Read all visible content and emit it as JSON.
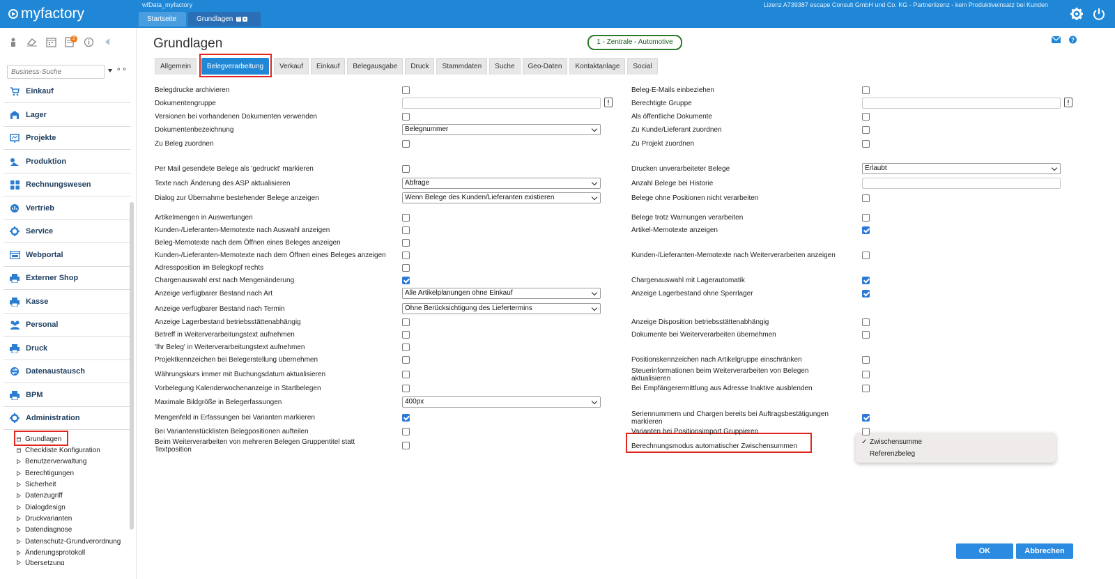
{
  "app": {
    "logo": "myfactory",
    "db_name": "wfData_myfactory",
    "license": "Lizenz A739387 escape Consult GmbH und Co. KG - Partnerlizenz - kein Produktiveinsatz bei Kunden",
    "top_tabs": [
      {
        "label": "Startseite"
      },
      {
        "label": "Grundlagen"
      }
    ],
    "accent": "#1f87d6"
  },
  "sidebar": {
    "notif_badge": "2",
    "search_placeholder": "Business-Suche",
    "search_options_icon": "⚬⚬",
    "items": [
      {
        "label": "Einkauf",
        "icon": "cart-icon"
      },
      {
        "label": "Lager",
        "icon": "warehouse-icon"
      },
      {
        "label": "Projekte",
        "icon": "project-icon"
      },
      {
        "label": "Produktion",
        "icon": "production-icon"
      },
      {
        "label": "Rechnungswesen",
        "icon": "grid-icon"
      },
      {
        "label": "Vertrieb",
        "icon": "sales-icon"
      },
      {
        "label": "Service",
        "icon": "service-gear-icon"
      },
      {
        "label": "Webportal",
        "icon": "webportal-icon"
      },
      {
        "label": "Externer Shop",
        "icon": "printer-icon"
      },
      {
        "label": "Kasse",
        "icon": "register-icon"
      },
      {
        "label": "Personal",
        "icon": "people-icon"
      },
      {
        "label": "Druck",
        "icon": "printer-icon"
      },
      {
        "label": "Datenaustausch",
        "icon": "exchange-icon"
      },
      {
        "label": "BPM",
        "icon": "printer-icon"
      },
      {
        "label": "Administration",
        "icon": "admin-gear-icon"
      }
    ],
    "subitems": [
      {
        "label": "Grundlagen"
      },
      {
        "label": "Checkliste Konfiguration"
      },
      {
        "label": "Benutzerverwaltung"
      },
      {
        "label": "Berechtigungen"
      },
      {
        "label": "Sicherheit"
      },
      {
        "label": "Datenzugriff"
      },
      {
        "label": "Dialogdesign"
      },
      {
        "label": "Druckvarianten"
      },
      {
        "label": "Datendiagnose"
      },
      {
        "label": "Datenschutz-Grundverordnung"
      },
      {
        "label": "Änderungsprotokoll"
      },
      {
        "label": "Übersetzung"
      }
    ]
  },
  "main": {
    "title": "Grundlagen",
    "mandant": "1 - Zentrale - Automotive",
    "tabs": [
      {
        "label": "Allgemein"
      },
      {
        "label": "Belegverarbeitung"
      },
      {
        "label": "Verkauf"
      },
      {
        "label": "Einkauf"
      },
      {
        "label": "Belegausgabe"
      },
      {
        "label": "Druck"
      },
      {
        "label": "Stammdaten"
      },
      {
        "label": "Suche"
      },
      {
        "label": "Geo-Daten"
      },
      {
        "label": "Kontaktanlage"
      },
      {
        "label": "Social"
      }
    ],
    "left_settings": [
      {
        "label": "Belegdrucke archivieren",
        "type": "checkbox",
        "checked": false
      },
      {
        "label": "Dokumentengruppe",
        "type": "text",
        "value": ""
      },
      {
        "label": "Versionen bei vorhandenen Dokumenten verwenden",
        "type": "checkbox",
        "checked": false
      },
      {
        "label": "Dokumentenbezeichnung",
        "type": "select",
        "value": "Belegnummer"
      },
      {
        "label": "Zu Beleg zuordnen",
        "type": "checkbox",
        "checked": false
      },
      {
        "label": "Per Mail gesendete Belege als 'gedruckt' markieren",
        "type": "checkbox",
        "checked": false
      },
      {
        "label": "Texte nach Änderung des ASP aktualisieren",
        "type": "select",
        "value": "Abfrage"
      },
      {
        "label": "Dialog zur Übernahme bestehender Belege anzeigen",
        "type": "select",
        "value": "Wenn Belege des Kunden/Lieferanten existieren"
      },
      {
        "label": "Artikelmengen in Auswertungen",
        "type": "checkbox",
        "checked": false
      },
      {
        "label": "Kunden-/Lieferanten-Memotexte nach Auswahl anzeigen",
        "type": "checkbox",
        "checked": false
      },
      {
        "label": "Beleg-Memotexte nach dem Öffnen eines Beleges anzeigen",
        "type": "checkbox",
        "checked": false
      },
      {
        "label": "Kunden-/Lieferanten-Memotexte nach dem Öffnen eines Beleges anzeigen",
        "type": "checkbox",
        "checked": false
      },
      {
        "label": "Adressposition im Belegkopf rechts",
        "type": "checkbox",
        "checked": false
      },
      {
        "label": "Chargenauswahl erst nach Mengenänderung",
        "type": "checkbox",
        "checked": true
      },
      {
        "label": "Anzeige verfügbarer Bestand nach Art",
        "type": "select",
        "value": "Alle Artikelplanungen ohne Einkauf"
      },
      {
        "label": "Anzeige verfügbarer Bestand nach Termin",
        "type": "select",
        "value": "Ohne Berücksichtigung des Liefertermins"
      },
      {
        "label": "Anzeige Lagerbestand betriebsstättenabhängig",
        "type": "checkbox",
        "checked": false
      },
      {
        "label": "Betreff in Weiterverarbeitungstext aufnehmen",
        "type": "checkbox",
        "checked": false
      },
      {
        "label": "'Ihr Beleg' in Weiterverarbeitungstext aufnehmen",
        "type": "checkbox",
        "checked": false
      },
      {
        "label": "Projektkennzeichen bei Belegerstellung übernehmen",
        "type": "checkbox",
        "checked": false
      },
      {
        "label": "Währungskurs immer mit Buchungsdatum aktualisieren",
        "type": "checkbox",
        "checked": false
      },
      {
        "label": "Vorbelegung Kalenderwochenanzeige in Startbelegen",
        "type": "checkbox",
        "checked": false
      },
      {
        "label": "Maximale Bildgröße in Belegerfassungen",
        "type": "select",
        "value": "400px"
      },
      {
        "label": "Mengenfeld in Erfassungen bei Varianten markieren",
        "type": "checkbox",
        "checked": true
      },
      {
        "label": "Bei Variantenstücklisten Belegpositionen aufteilen",
        "type": "checkbox",
        "checked": false
      },
      {
        "label": "Beim Weiterverarbeiten von mehreren Belegen Gruppentitel statt",
        "label2": "Textposition",
        "type": "checkbox",
        "checked": false
      }
    ],
    "right_settings": [
      {
        "label": "Beleg-E-Mails einbeziehen",
        "type": "checkbox",
        "checked": false
      },
      {
        "label": "Berechtigte Gruppe",
        "type": "text",
        "value": ""
      },
      {
        "label": "Als öffentliche Dokumente",
        "type": "checkbox",
        "checked": false
      },
      {
        "label": "Zu Kunde/Lieferant zuordnen",
        "type": "checkbox",
        "checked": false
      },
      {
        "label": "Zu Projekt zuordnen",
        "type": "checkbox",
        "checked": false
      },
      {
        "label": "Drucken unverarbeiteter Belege",
        "type": "select",
        "value": "Erlaubt"
      },
      {
        "label": "Anzahl Belege bei Historie",
        "type": "text",
        "value": ""
      },
      {
        "label": "Belege ohne Positionen nicht verarbeiten",
        "type": "checkbox",
        "checked": false
      },
      {
        "label": "Belege trotz Warnungen verarbeiten",
        "type": "checkbox",
        "checked": false
      },
      {
        "label": "Artikel-Memotexte anzeigen",
        "type": "checkbox",
        "checked": true
      },
      {
        "label": "Kunden-/Lieferanten-Memotexte nach Weiterverarbeiten anzeigen",
        "type": "checkbox",
        "checked": false
      },
      {
        "label": "Chargenauswahl mit Lagerautomatik",
        "type": "checkbox",
        "checked": true
      },
      {
        "label": "Anzeige Lagerbestand ohne Sperrlager",
        "type": "checkbox",
        "checked": true
      },
      {
        "label": "Anzeige Disposition betriebsstättenabhängig",
        "type": "checkbox",
        "checked": false
      },
      {
        "label": "Dokumente bei Weiterverarbeiten übernehmen",
        "type": "checkbox",
        "checked": false
      },
      {
        "label": "Positionskennzeichen nach Artikelgruppe einschränken",
        "type": "checkbox",
        "checked": false
      },
      {
        "label": "Steuerinformationen beim Weiterverarbeiten von Belegen",
        "label2": "aktualisieren",
        "type": "checkbox",
        "checked": false
      },
      {
        "label": "Bei Empfängerermittlung aus Adresse Inaktive ausblenden",
        "type": "checkbox",
        "checked": false
      },
      {
        "label": "Seriennummern und Chargen bereits bei Auftragsbestätigungen",
        "label2": "markieren",
        "type": "checkbox",
        "checked": true
      },
      {
        "label": "Varianten bei Positionsimport Gruppieren",
        "type": "checkbox",
        "checked": false
      },
      {
        "label": "Berechnungsmodus automatischer Zwischensummen",
        "type": "select-open",
        "value": ""
      }
    ],
    "dropdown_options": [
      {
        "label": "Zwischensumme",
        "selected": true
      },
      {
        "label": "Referenzbeleg",
        "selected": false
      }
    ],
    "dropdown_check": "✓",
    "ok_label": "OK",
    "cancel_label": "Abbrechen"
  }
}
